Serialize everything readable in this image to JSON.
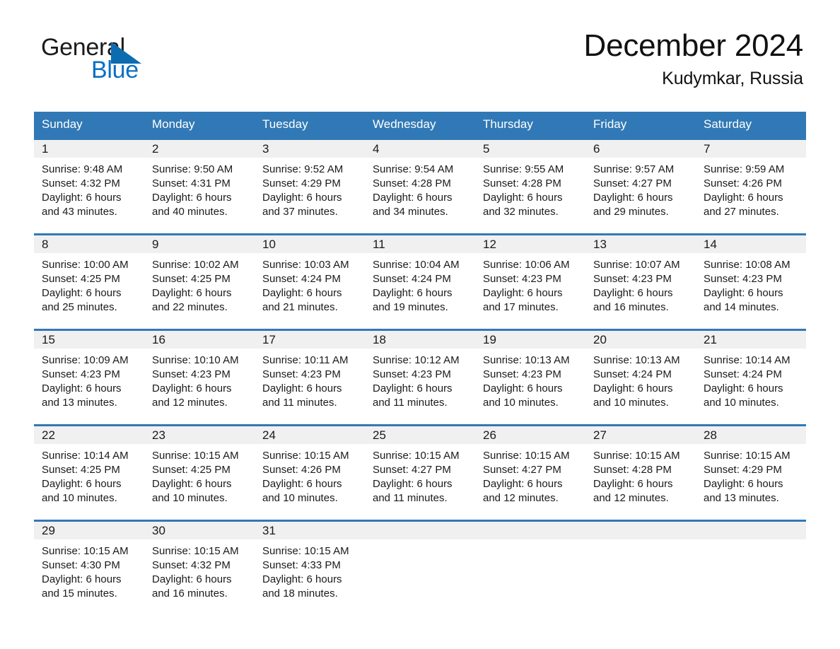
{
  "brand": {
    "name_part1": "General",
    "name_part2": "Blue",
    "triangle_color": "#0d6cb0",
    "blue_text_color": "#0b6fc4"
  },
  "header": {
    "month_title": "December 2024",
    "location": "Kudymkar, Russia"
  },
  "theme": {
    "header_blue": "#3179b6",
    "date_strip_gray": "#f0f0f0",
    "text_color": "#1a1a1a"
  },
  "weekday_headers": [
    "Sunday",
    "Monday",
    "Tuesday",
    "Wednesday",
    "Thursday",
    "Friday",
    "Saturday"
  ],
  "weeks": [
    [
      {
        "date": "1",
        "sunrise": "Sunrise: 9:48 AM",
        "sunset": "Sunset: 4:32 PM",
        "daylight1": "Daylight: 6 hours",
        "daylight2": "and 43 minutes."
      },
      {
        "date": "2",
        "sunrise": "Sunrise: 9:50 AM",
        "sunset": "Sunset: 4:31 PM",
        "daylight1": "Daylight: 6 hours",
        "daylight2": "and 40 minutes."
      },
      {
        "date": "3",
        "sunrise": "Sunrise: 9:52 AM",
        "sunset": "Sunset: 4:29 PM",
        "daylight1": "Daylight: 6 hours",
        "daylight2": "and 37 minutes."
      },
      {
        "date": "4",
        "sunrise": "Sunrise: 9:54 AM",
        "sunset": "Sunset: 4:28 PM",
        "daylight1": "Daylight: 6 hours",
        "daylight2": "and 34 minutes."
      },
      {
        "date": "5",
        "sunrise": "Sunrise: 9:55 AM",
        "sunset": "Sunset: 4:28 PM",
        "daylight1": "Daylight: 6 hours",
        "daylight2": "and 32 minutes."
      },
      {
        "date": "6",
        "sunrise": "Sunrise: 9:57 AM",
        "sunset": "Sunset: 4:27 PM",
        "daylight1": "Daylight: 6 hours",
        "daylight2": "and 29 minutes."
      },
      {
        "date": "7",
        "sunrise": "Sunrise: 9:59 AM",
        "sunset": "Sunset: 4:26 PM",
        "daylight1": "Daylight: 6 hours",
        "daylight2": "and 27 minutes."
      }
    ],
    [
      {
        "date": "8",
        "sunrise": "Sunrise: 10:00 AM",
        "sunset": "Sunset: 4:25 PM",
        "daylight1": "Daylight: 6 hours",
        "daylight2": "and 25 minutes."
      },
      {
        "date": "9",
        "sunrise": "Sunrise: 10:02 AM",
        "sunset": "Sunset: 4:25 PM",
        "daylight1": "Daylight: 6 hours",
        "daylight2": "and 22 minutes."
      },
      {
        "date": "10",
        "sunrise": "Sunrise: 10:03 AM",
        "sunset": "Sunset: 4:24 PM",
        "daylight1": "Daylight: 6 hours",
        "daylight2": "and 21 minutes."
      },
      {
        "date": "11",
        "sunrise": "Sunrise: 10:04 AM",
        "sunset": "Sunset: 4:24 PM",
        "daylight1": "Daylight: 6 hours",
        "daylight2": "and 19 minutes."
      },
      {
        "date": "12",
        "sunrise": "Sunrise: 10:06 AM",
        "sunset": "Sunset: 4:23 PM",
        "daylight1": "Daylight: 6 hours",
        "daylight2": "and 17 minutes."
      },
      {
        "date": "13",
        "sunrise": "Sunrise: 10:07 AM",
        "sunset": "Sunset: 4:23 PM",
        "daylight1": "Daylight: 6 hours",
        "daylight2": "and 16 minutes."
      },
      {
        "date": "14",
        "sunrise": "Sunrise: 10:08 AM",
        "sunset": "Sunset: 4:23 PM",
        "daylight1": "Daylight: 6 hours",
        "daylight2": "and 14 minutes."
      }
    ],
    [
      {
        "date": "15",
        "sunrise": "Sunrise: 10:09 AM",
        "sunset": "Sunset: 4:23 PM",
        "daylight1": "Daylight: 6 hours",
        "daylight2": "and 13 minutes."
      },
      {
        "date": "16",
        "sunrise": "Sunrise: 10:10 AM",
        "sunset": "Sunset: 4:23 PM",
        "daylight1": "Daylight: 6 hours",
        "daylight2": "and 12 minutes."
      },
      {
        "date": "17",
        "sunrise": "Sunrise: 10:11 AM",
        "sunset": "Sunset: 4:23 PM",
        "daylight1": "Daylight: 6 hours",
        "daylight2": "and 11 minutes."
      },
      {
        "date": "18",
        "sunrise": "Sunrise: 10:12 AM",
        "sunset": "Sunset: 4:23 PM",
        "daylight1": "Daylight: 6 hours",
        "daylight2": "and 11 minutes."
      },
      {
        "date": "19",
        "sunrise": "Sunrise: 10:13 AM",
        "sunset": "Sunset: 4:23 PM",
        "daylight1": "Daylight: 6 hours",
        "daylight2": "and 10 minutes."
      },
      {
        "date": "20",
        "sunrise": "Sunrise: 10:13 AM",
        "sunset": "Sunset: 4:24 PM",
        "daylight1": "Daylight: 6 hours",
        "daylight2": "and 10 minutes."
      },
      {
        "date": "21",
        "sunrise": "Sunrise: 10:14 AM",
        "sunset": "Sunset: 4:24 PM",
        "daylight1": "Daylight: 6 hours",
        "daylight2": "and 10 minutes."
      }
    ],
    [
      {
        "date": "22",
        "sunrise": "Sunrise: 10:14 AM",
        "sunset": "Sunset: 4:25 PM",
        "daylight1": "Daylight: 6 hours",
        "daylight2": "and 10 minutes."
      },
      {
        "date": "23",
        "sunrise": "Sunrise: 10:15 AM",
        "sunset": "Sunset: 4:25 PM",
        "daylight1": "Daylight: 6 hours",
        "daylight2": "and 10 minutes."
      },
      {
        "date": "24",
        "sunrise": "Sunrise: 10:15 AM",
        "sunset": "Sunset: 4:26 PM",
        "daylight1": "Daylight: 6 hours",
        "daylight2": "and 10 minutes."
      },
      {
        "date": "25",
        "sunrise": "Sunrise: 10:15 AM",
        "sunset": "Sunset: 4:27 PM",
        "daylight1": "Daylight: 6 hours",
        "daylight2": "and 11 minutes."
      },
      {
        "date": "26",
        "sunrise": "Sunrise: 10:15 AM",
        "sunset": "Sunset: 4:27 PM",
        "daylight1": "Daylight: 6 hours",
        "daylight2": "and 12 minutes."
      },
      {
        "date": "27",
        "sunrise": "Sunrise: 10:15 AM",
        "sunset": "Sunset: 4:28 PM",
        "daylight1": "Daylight: 6 hours",
        "daylight2": "and 12 minutes."
      },
      {
        "date": "28",
        "sunrise": "Sunrise: 10:15 AM",
        "sunset": "Sunset: 4:29 PM",
        "daylight1": "Daylight: 6 hours",
        "daylight2": "and 13 minutes."
      }
    ],
    [
      {
        "date": "29",
        "sunrise": "Sunrise: 10:15 AM",
        "sunset": "Sunset: 4:30 PM",
        "daylight1": "Daylight: 6 hours",
        "daylight2": "and 15 minutes."
      },
      {
        "date": "30",
        "sunrise": "Sunrise: 10:15 AM",
        "sunset": "Sunset: 4:32 PM",
        "daylight1": "Daylight: 6 hours",
        "daylight2": "and 16 minutes."
      },
      {
        "date": "31",
        "sunrise": "Sunrise: 10:15 AM",
        "sunset": "Sunset: 4:33 PM",
        "daylight1": "Daylight: 6 hours",
        "daylight2": "and 18 minutes."
      },
      {
        "date": "",
        "sunrise": "",
        "sunset": "",
        "daylight1": "",
        "daylight2": ""
      },
      {
        "date": "",
        "sunrise": "",
        "sunset": "",
        "daylight1": "",
        "daylight2": ""
      },
      {
        "date": "",
        "sunrise": "",
        "sunset": "",
        "daylight1": "",
        "daylight2": ""
      },
      {
        "date": "",
        "sunrise": "",
        "sunset": "",
        "daylight1": "",
        "daylight2": ""
      }
    ]
  ]
}
